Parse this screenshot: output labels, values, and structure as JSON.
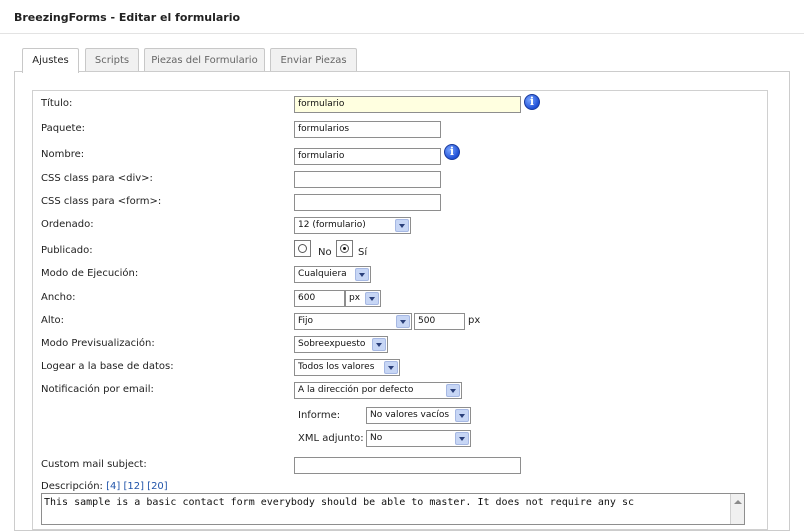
{
  "header": {
    "title": "BreezingForms - Editar el formulario"
  },
  "tabs": [
    {
      "label": "Ajustes",
      "active": true
    },
    {
      "label": "Scripts",
      "active": false
    },
    {
      "label": "Piezas del Formulario",
      "active": false
    },
    {
      "label": "Enviar Piezas",
      "active": false
    }
  ],
  "form": {
    "titulo": {
      "label": "Título:",
      "value": "formulario"
    },
    "paquete": {
      "label": "Paquete:",
      "value": "formularios"
    },
    "nombre": {
      "label": "Nombre:",
      "value": "formulario"
    },
    "css_div": {
      "label": "CSS class para <div>:",
      "value": ""
    },
    "css_form": {
      "label": "CSS class para <form>:",
      "value": ""
    },
    "ordenado": {
      "label": "Ordenado:",
      "value": "12 (formulario)"
    },
    "publicado": {
      "label": "Publicado:",
      "options": [
        "No",
        "Sí"
      ],
      "selected": "Sí"
    },
    "modo_ejecucion": {
      "label": "Modo de Ejecución:",
      "value": "Cualquiera"
    },
    "ancho": {
      "label": "Ancho:",
      "value": "600",
      "unit": "px"
    },
    "alto": {
      "label": "Alto:",
      "mode": "Fijo",
      "value": "500",
      "unit": "px"
    },
    "modo_previsualizacion": {
      "label": "Modo Previsualización:",
      "value": "Sobreexpuesto"
    },
    "logear": {
      "label": "Logear a la base de datos:",
      "value": "Todos los valores"
    },
    "notificacion": {
      "label": "Notificación por email:",
      "value": "A la dirección por defecto"
    },
    "informe": {
      "label": "Informe:",
      "value": "No valores vacíos"
    },
    "xml_adjunto": {
      "label": "XML adjunto:",
      "value": "No"
    },
    "custom_subject": {
      "label": "Custom mail subject:",
      "value": ""
    },
    "descripcion": {
      "label": "Descripción:",
      "links": [
        "[4]",
        "[12]",
        "[20]"
      ],
      "value": "This sample is a basic contact form everybody should be able to master. It does not require any sc"
    }
  },
  "icons": {
    "info": "info-icon",
    "dropdown": "chevron-down-icon"
  },
  "colors": {
    "highlight_field": "#ffffe0",
    "dropdown_button": "#c7d6f5",
    "info_icon": "#1f4fd6",
    "link": "#2255aa"
  }
}
